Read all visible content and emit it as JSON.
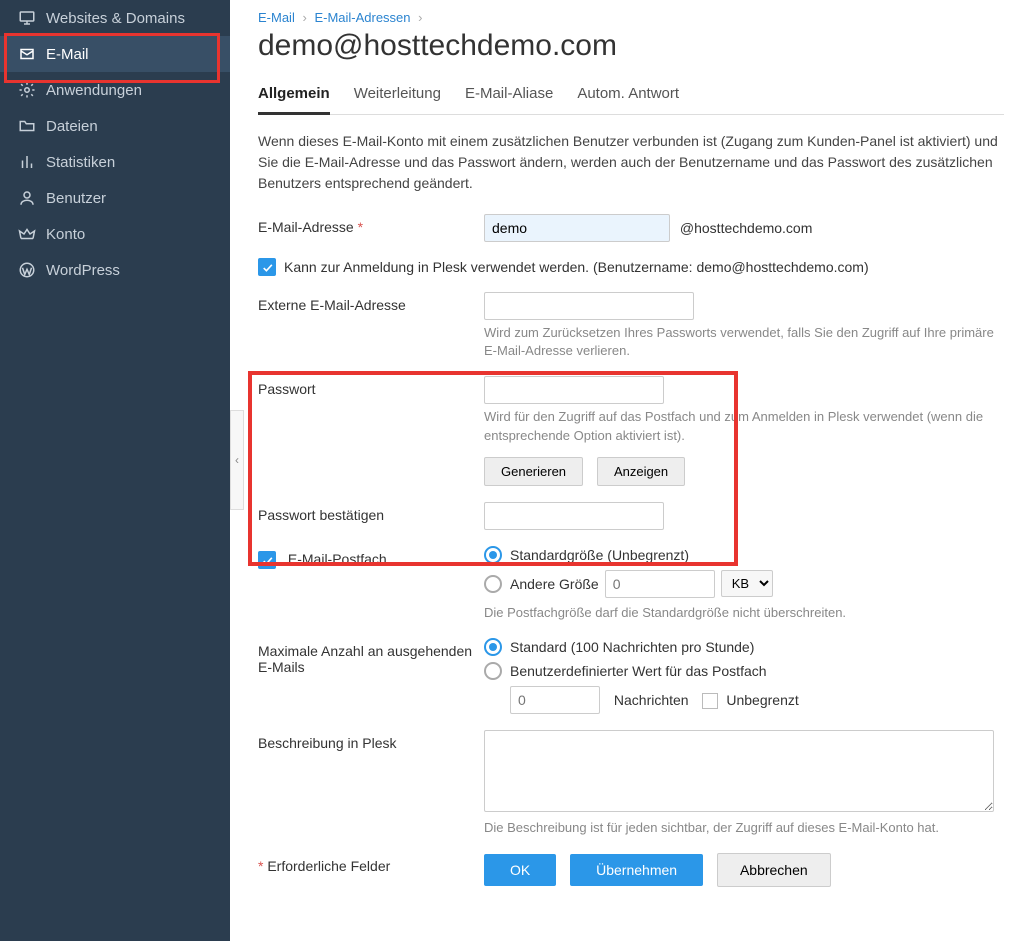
{
  "sidebar": {
    "items": [
      {
        "label": "Websites & Domains",
        "icon": "monitor"
      },
      {
        "label": "E-Mail",
        "icon": "mail",
        "active": true
      },
      {
        "label": "Anwendungen",
        "icon": "gear"
      },
      {
        "label": "Dateien",
        "icon": "folder"
      },
      {
        "label": "Statistiken",
        "icon": "stats"
      },
      {
        "label": "Benutzer",
        "icon": "user"
      },
      {
        "label": "Konto",
        "icon": "crown"
      },
      {
        "label": "WordPress",
        "icon": "wordpress"
      }
    ]
  },
  "breadcrumb": {
    "a": "E-Mail",
    "b": "E-Mail-Adressen"
  },
  "page_title": "demo@hosttechdemo.com",
  "tabs": [
    {
      "label": "Allgemein",
      "active": true
    },
    {
      "label": "Weiterleitung"
    },
    {
      "label": "E-Mail-Aliase"
    },
    {
      "label": "Autom. Antwort"
    }
  ],
  "intro": "Wenn dieses E-Mail-Konto mit einem zusätzlichen Benutzer verbunden ist (Zugang zum Kunden-Panel ist aktiviert) und Sie die E-Mail-Adresse und das Passwort ändern, werden auch der Benutzername und das Passwort des zusätzlichen Benutzers entsprechend geändert.",
  "fields": {
    "email_label": "E-Mail-Adresse",
    "email_value": "demo",
    "email_domain": "@hosttechdemo.com",
    "login_checkbox": "Kann zur Anmeldung in Plesk verwendet werden.  (Benutzername: demo@hosttechdemo.com)",
    "external_label": "Externe E-Mail-Adresse",
    "external_help": "Wird zum Zurücksetzen Ihres Passworts verwendet, falls Sie den Zugriff auf Ihre primäre E-Mail-Adresse verlieren.",
    "password_label": "Passwort",
    "password_help": "Wird für den Zugriff auf das Postfach und zum Anmelden in Plesk verwendet (wenn die entsprechende Option aktiviert ist).",
    "generate_btn": "Generieren",
    "show_btn": "Anzeigen",
    "password_confirm_label": "Passwort bestätigen",
    "mailbox_label": "E-Mail-Postfach",
    "size_default": "Standardgröße (Unbegrenzt)",
    "size_other": "Andere Größe",
    "size_placeholder": "0",
    "size_unit": "KB",
    "size_help": "Die Postfachgröße darf die Standardgröße nicht überschreiten.",
    "outgoing_label": "Maximale Anzahl an ausgehenden E-Mails",
    "outgoing_default": "Standard (100 Nachrichten pro Stunde)",
    "outgoing_custom": "Benutzerdefinierter Wert für das Postfach",
    "outgoing_placeholder": "0",
    "outgoing_unit": "Nachrichten",
    "outgoing_unlimited": "Unbegrenzt",
    "description_label": "Beschreibung in Plesk",
    "description_help": "Die Beschreibung ist für jeden sichtbar, der Zugriff auf dieses E-Mail-Konto hat.",
    "required_note": "Erforderliche Felder"
  },
  "buttons": {
    "ok": "OK",
    "apply": "Übernehmen",
    "cancel": "Abbrechen"
  }
}
